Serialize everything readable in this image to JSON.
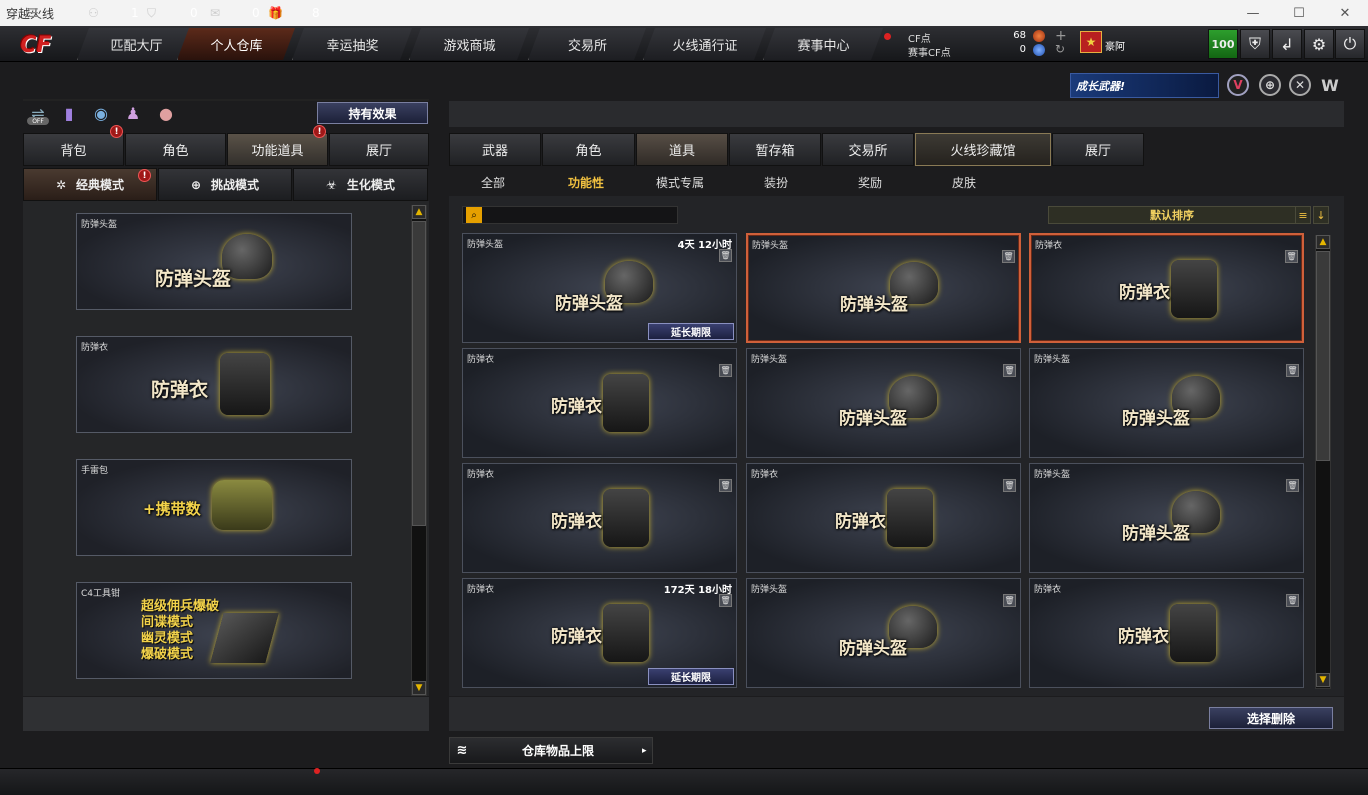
{
  "window": {
    "title": "穿越火线",
    "min": "—",
    "max": "☐",
    "close": "✕"
  },
  "nav": {
    "logo": "CF",
    "tabs": [
      "匹配大厅",
      "个人仓库",
      "幸运抽奖",
      "游戏商城",
      "交易所",
      "火线通行证",
      "赛事中心"
    ],
    "active_index": 1
  },
  "currency": {
    "cf_label": "CF点",
    "cf_value": "68",
    "match_label": "赛事CF点",
    "match_value": "0",
    "rank_label": "豪阿"
  },
  "topbuttons": {
    "level": "100"
  },
  "effects_button": "持有效果",
  "left": {
    "off_label": "OFF",
    "tabs": [
      "背包",
      "角色",
      "功能道具",
      "展厅"
    ],
    "modes": [
      "经典模式",
      "挑战模式",
      "生化模式"
    ],
    "cards": [
      {
        "name": "防弹头盔",
        "big": "防弹头盔"
      },
      {
        "name": "防弹衣",
        "big": "防弹衣"
      },
      {
        "name": "手雷包",
        "big": "+携带数"
      },
      {
        "name": "C4工具钳",
        "lines": [
          "超级佣兵爆破",
          "间谍模式",
          "幽灵模式",
          "爆破模式"
        ]
      }
    ]
  },
  "banner": {
    "text": "成长武器!"
  },
  "right": {
    "tabs": [
      "武器",
      "角色",
      "道具",
      "暂存箱",
      "交易所",
      "火线珍藏馆",
      "展厅"
    ],
    "subtabs": [
      "全部",
      "功能性",
      "模式专属",
      "装扮",
      "奖励",
      "皮肤"
    ],
    "sort_label": "默认排序",
    "items": [
      {
        "name": "防弹头盔",
        "big": "防弹头盔",
        "time": "4天 12小时",
        "extend": "延长期限"
      },
      {
        "name": "防弹头盔",
        "big": "防弹头盔"
      },
      {
        "name": "防弹衣",
        "big": "防弹衣"
      },
      {
        "name": "防弹衣",
        "big": "防弹衣"
      },
      {
        "name": "防弹头盔",
        "big": "防弹头盔"
      },
      {
        "name": "防弹头盔",
        "big": "防弹头盔"
      },
      {
        "name": "防弹衣",
        "big": "防弹衣"
      },
      {
        "name": "防弹衣",
        "big": "防弹衣"
      },
      {
        "name": "防弹头盔",
        "big": "防弹头盔"
      },
      {
        "name": "防弹衣",
        "big": "防弹衣",
        "time": "172天 18小时",
        "extend": "延长期限"
      },
      {
        "name": "防弹头盔",
        "big": "防弹头盔"
      },
      {
        "name": "防弹衣",
        "big": "防弹衣"
      }
    ],
    "delete_button": "选择删除",
    "limit_label": "仓库物品上限"
  },
  "status": {
    "friends": "1",
    "messages": "0",
    "gifts": "0",
    "notifications": "8"
  },
  "colors": {
    "accent_orange": "#d0603a",
    "gold": "#f0c040",
    "alert_red": "#d22"
  }
}
